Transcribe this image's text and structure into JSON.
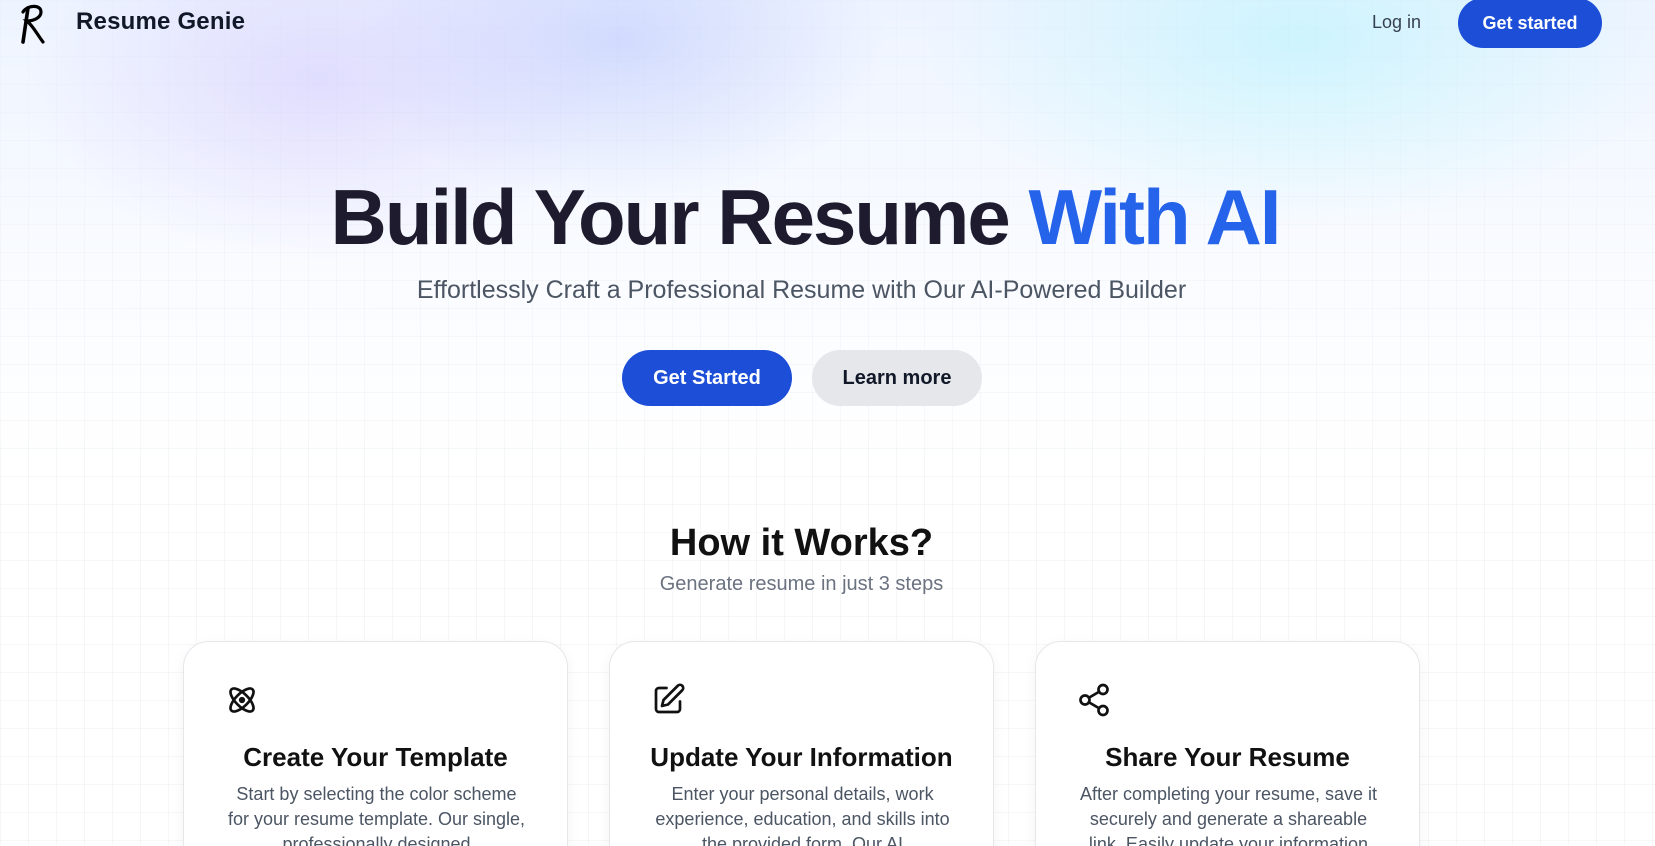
{
  "nav": {
    "brand": "Resume Genie",
    "login_label": "Log in",
    "cta_label": "Get started"
  },
  "hero": {
    "title_part1": "Build Your Resume",
    "title_part2": "With AI",
    "subtitle": "Effortlessly Craft a Professional Resume with Our AI-Powered Builder",
    "primary_button": "Get Started",
    "secondary_button": "Learn more"
  },
  "how": {
    "title": "How it Works?",
    "subtitle": "Generate resume in just 3 steps",
    "cards": [
      {
        "icon": "atom-icon",
        "title": "Create Your Template",
        "text": "Start by selecting the color scheme for your resume template. Our single, professionally designed"
      },
      {
        "icon": "edit-square-icon",
        "title": "Update Your Information",
        "text": "Enter your personal details, work experience, education, and skills into the provided form. Our AI"
      },
      {
        "icon": "share-icon",
        "title": "Share Your Resume",
        "text": "After completing your resume, save it securely and generate a shareable link. Easily update your information"
      }
    ]
  },
  "colors": {
    "accent": "#2563eb",
    "button_primary": "#1d4ed8",
    "button_secondary": "#e5e7eb",
    "heading_dark": "#1e1b2e"
  }
}
